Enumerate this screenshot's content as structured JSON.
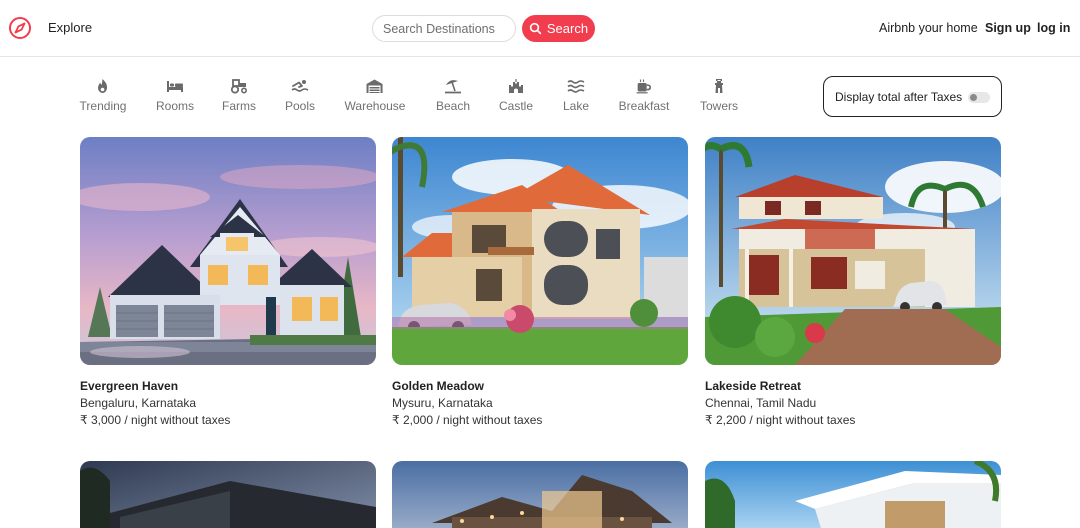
{
  "header": {
    "logo_icon": "compass-icon",
    "explore_label": "Explore",
    "search_placeholder": "Search Destinations",
    "search_button_label": "Search",
    "host_label": "Airbnb your home",
    "signup_label": "Sign up",
    "login_label": "log in",
    "accent_color": "#f23d4f"
  },
  "categories": [
    {
      "label": "Trending",
      "icon": "flame-icon"
    },
    {
      "label": "Rooms",
      "icon": "bed-icon"
    },
    {
      "label": "Farms",
      "icon": "tractor-icon"
    },
    {
      "label": "Pools",
      "icon": "swimmer-icon"
    },
    {
      "label": "Warehouse",
      "icon": "warehouse-icon"
    },
    {
      "label": "Beach",
      "icon": "umbrella-beach-icon"
    },
    {
      "label": "Castle",
      "icon": "castle-icon"
    },
    {
      "label": "Lake",
      "icon": "water-waves-icon"
    },
    {
      "label": "Breakfast",
      "icon": "coffee-mug-icon"
    },
    {
      "label": "Towers",
      "icon": "tower-icon"
    }
  ],
  "tax_toggle": {
    "label": "Display total after Taxes",
    "enabled": false
  },
  "listings": [
    {
      "title": "Evergreen Haven",
      "location": "Bengaluru, Karnataka",
      "price": "₹ 3,000 / night without taxes"
    },
    {
      "title": "Golden Meadow",
      "location": "Mysuru, Karnataka",
      "price": "₹ 2,000 / night without taxes"
    },
    {
      "title": "Lakeside Retreat",
      "location": "Chennai, Tamil Nadu",
      "price": "₹ 2,200 / night without taxes"
    }
  ]
}
